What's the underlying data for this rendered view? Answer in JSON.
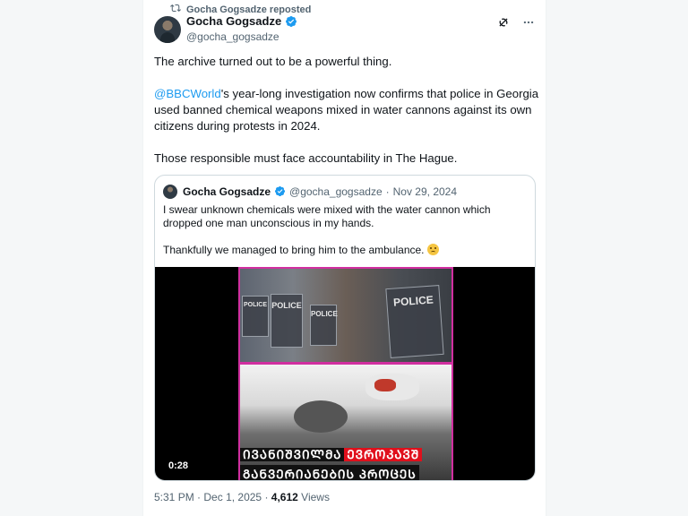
{
  "colors": {
    "accent": "#1d9bf0",
    "verified": "#1d9bf0",
    "muted_text": "#536471",
    "video_border": "#d12fa0",
    "caption_red": "#e0101c"
  },
  "repost_label": "Gocha Gogsadze reposted",
  "author": {
    "name": "Gocha Gogsadze",
    "handle": "@gocha_gogsadze",
    "verified": true
  },
  "icons": {
    "repost": "repost-icon",
    "grok": "grok-icon",
    "more": "more-icon",
    "verified": "verified-badge-icon"
  },
  "post": {
    "line1": "The archive turned out to be a powerful thing.",
    "mention": "@BBCWorld",
    "line2_rest": "'s year-long investigation now confirms that police in Georgia used banned chemical weapons mixed in water cannons against its own citizens during protests in 2024.",
    "line3": "Those responsible must face accountability in The Hague."
  },
  "quote": {
    "name": "Gocha Gogsadze",
    "handle": "@gocha_gogsadze",
    "separator": "·",
    "date": "Nov 29, 2024",
    "text1": "I swear unknown chemicals were mixed with the water cannon which dropped one man unconscious in my hands.",
    "text2": "Thankfully we managed to bring him to the ambulance.",
    "video": {
      "duration": "0:28",
      "shield_labels": [
        "POLICE",
        "POLICE",
        "POLICE",
        "POLICE"
      ],
      "caption_line1_white": "ᲘᲕᲐᲜᲘᲨᲕᲘᲚᲛᲐ",
      "caption_line1_red": "ᲔᲕᲠᲝᲙᲐᲕᲨ",
      "caption_line2": "ᲒᲐᲜᲕᲔᲠᲘᲐᲜᲔᲑᲘᲡ ᲞᲠᲝᲪᲔᲡ"
    }
  },
  "meta": {
    "time": "5:31 PM",
    "dot": "·",
    "date": "Dec 1, 2025",
    "views_count": "4,612",
    "views_label": "Views"
  }
}
